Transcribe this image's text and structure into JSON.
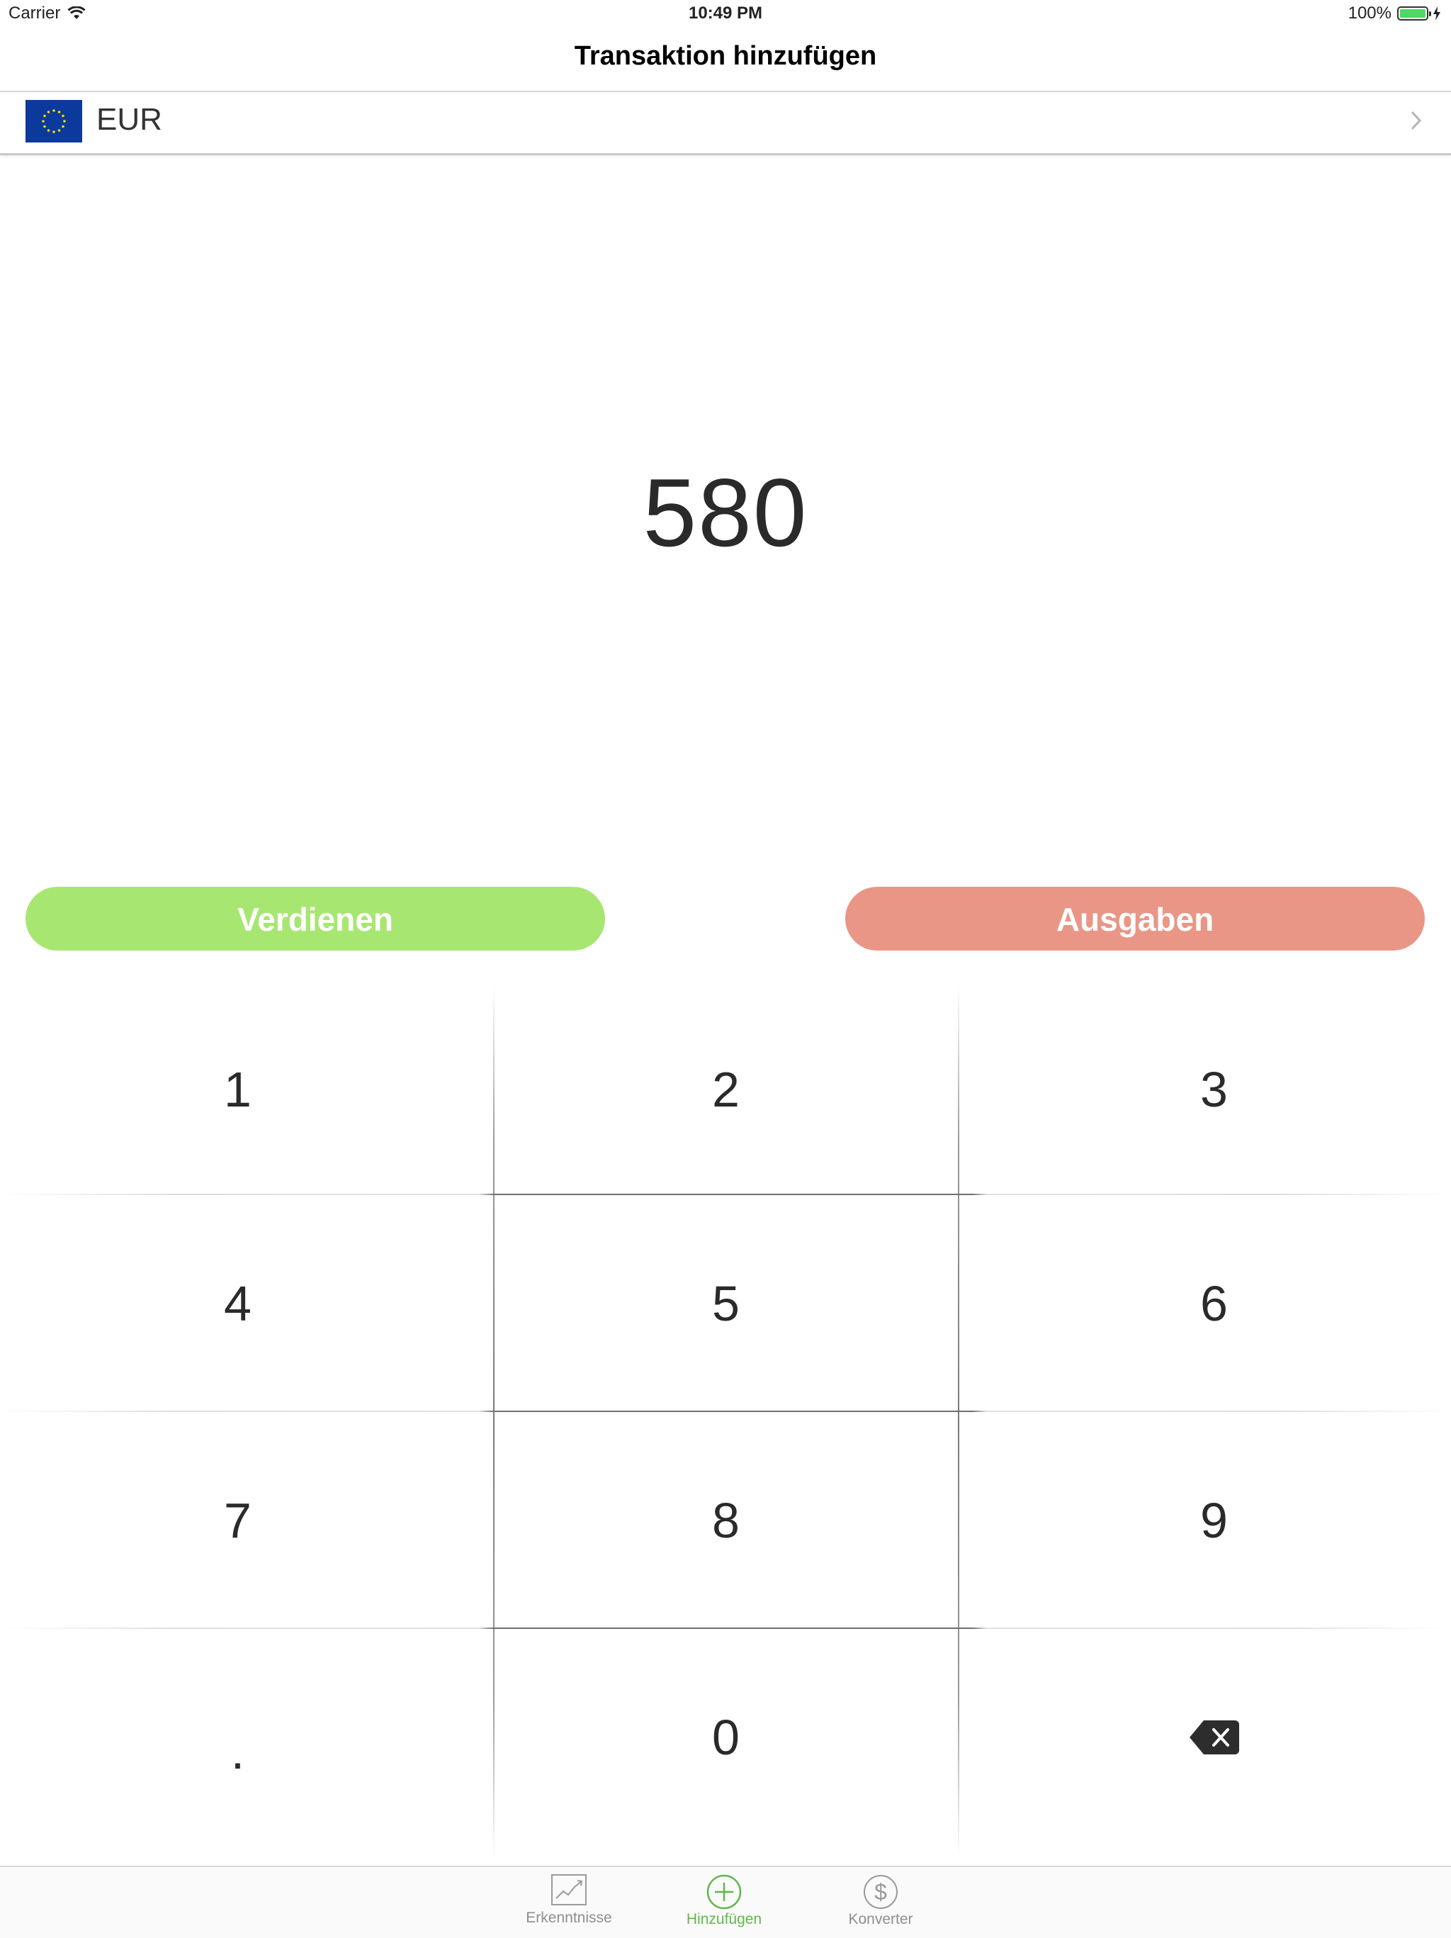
{
  "status_bar": {
    "carrier": "Carrier",
    "time": "10:49 PM",
    "battery": "100%",
    "battery_color": "#4cd964"
  },
  "nav": {
    "title": "Transaktion hinzufügen"
  },
  "currency": {
    "code": "EUR",
    "flag_icon": "eu-flag-icon"
  },
  "amount": {
    "value": "580"
  },
  "actions": {
    "earn_label": "Verdienen",
    "earn_color": "#a8e672",
    "spend_label": "Ausgaben",
    "spend_color": "#e99686"
  },
  "keypad": {
    "keys": [
      "1",
      "2",
      "3",
      "4",
      "5",
      "6",
      "7",
      "8",
      "9",
      ".",
      "0"
    ],
    "backspace_icon": "backspace-icon"
  },
  "tabs": {
    "insights": "Erkenntnisse",
    "add": "Hinzufügen",
    "converter": "Konverter",
    "active": "add",
    "active_color": "#5fb84a"
  }
}
